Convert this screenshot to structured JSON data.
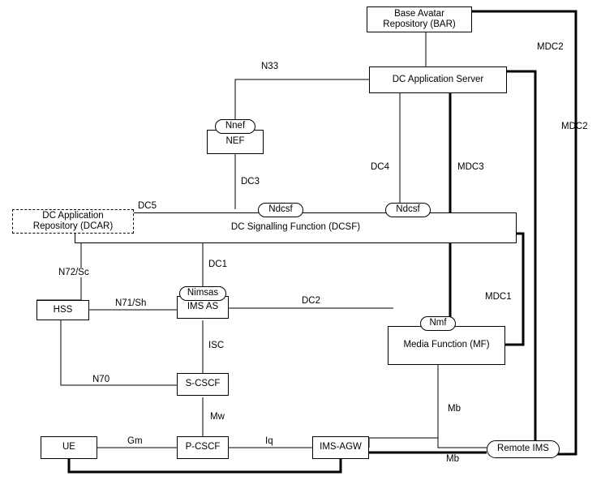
{
  "nodes": {
    "bar": {
      "label": "Base Avatar\nRepository (BAR)"
    },
    "dcas": {
      "label": "DC Application Server"
    },
    "nef": {
      "label": "NEF"
    },
    "nnef": {
      "label": "Nnef"
    },
    "ndcsf1": {
      "label": "Ndcsf"
    },
    "ndcsf2": {
      "label": "Ndcsf"
    },
    "dcsf": {
      "label": "DC Signalling Function (DCSF)"
    },
    "dcar": {
      "label": "DC Application\nRepository (DCAR)"
    },
    "hss": {
      "label": "HSS"
    },
    "imsas": {
      "label": "IMS AS"
    },
    "nimsas": {
      "label": "Nimsas"
    },
    "nmf": {
      "label": "Nmf"
    },
    "mf": {
      "label": "Media Function (MF)"
    },
    "scscf": {
      "label": "S-CSCF"
    },
    "pcscf": {
      "label": "P-CSCF"
    },
    "ue": {
      "label": "UE"
    },
    "agw": {
      "label": "IMS-AGW"
    },
    "rims": {
      "label": "Remote IMS"
    }
  },
  "labels": {
    "n33": "N33",
    "dc3": "DC3",
    "dc4": "DC4",
    "dc5": "DC5",
    "dc1": "DC1",
    "dc2": "DC2",
    "n72": "N72/Sc",
    "n71": "N71/Sh",
    "n70": "N70",
    "isc": "ISC",
    "mw": "Mw",
    "gm": "Gm",
    "iq": "Iq",
    "mb1": "Mb",
    "mb2": "Mb",
    "mdc1": "MDC1",
    "mdc2": "MDC2",
    "mdc2b": "MDC2",
    "mdc3": "MDC3"
  }
}
